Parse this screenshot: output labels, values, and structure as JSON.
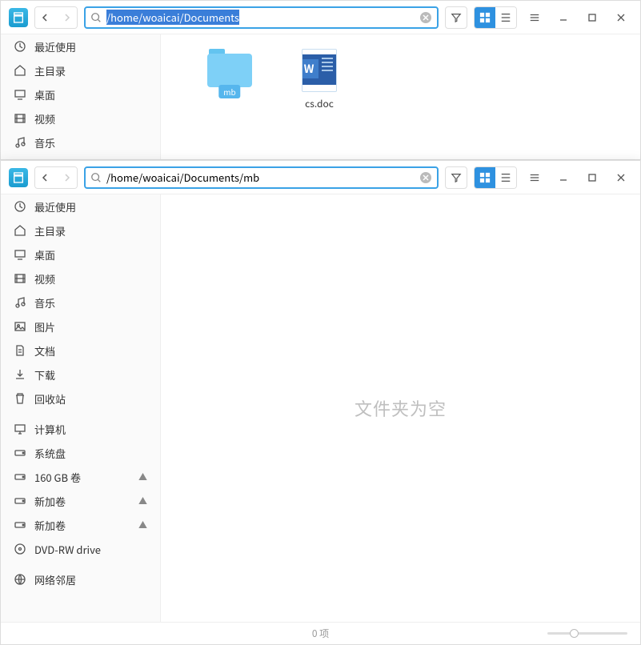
{
  "window1": {
    "path": "/home/woaicai/Documents",
    "sidebar": [
      {
        "icon": "clock",
        "label": "最近使用"
      },
      {
        "icon": "home",
        "label": "主目录"
      },
      {
        "icon": "desktop",
        "label": "桌面"
      },
      {
        "icon": "video",
        "label": "视频"
      },
      {
        "icon": "music",
        "label": "音乐"
      }
    ],
    "items": [
      {
        "type": "folder",
        "name": "mb",
        "badge": "mb"
      },
      {
        "type": "doc",
        "name": "cs.doc"
      }
    ]
  },
  "window2": {
    "path": "/home/woaicai/Documents/mb",
    "empty_text": "文件夹为空",
    "status_text": "0 项",
    "sidebar": [
      {
        "icon": "clock",
        "label": "最近使用"
      },
      {
        "icon": "home",
        "label": "主目录"
      },
      {
        "icon": "desktop",
        "label": "桌面"
      },
      {
        "icon": "video",
        "label": "视频"
      },
      {
        "icon": "music",
        "label": "音乐"
      },
      {
        "icon": "image",
        "label": "图片"
      },
      {
        "icon": "doc",
        "label": "文档"
      },
      {
        "icon": "download",
        "label": "下载"
      },
      {
        "icon": "trash",
        "label": "回收站"
      }
    ],
    "devices": [
      {
        "icon": "computer",
        "label": "计算机"
      },
      {
        "icon": "disk",
        "label": "系统盘"
      },
      {
        "icon": "disk",
        "label": "160 GB 卷",
        "eject": true
      },
      {
        "icon": "disk",
        "label": "新加卷",
        "eject": true
      },
      {
        "icon": "disk",
        "label": "新加卷",
        "eject": true
      },
      {
        "icon": "dvd",
        "label": "DVD-RW drive"
      }
    ],
    "network": [
      {
        "icon": "network",
        "label": "网络邻居"
      }
    ]
  }
}
